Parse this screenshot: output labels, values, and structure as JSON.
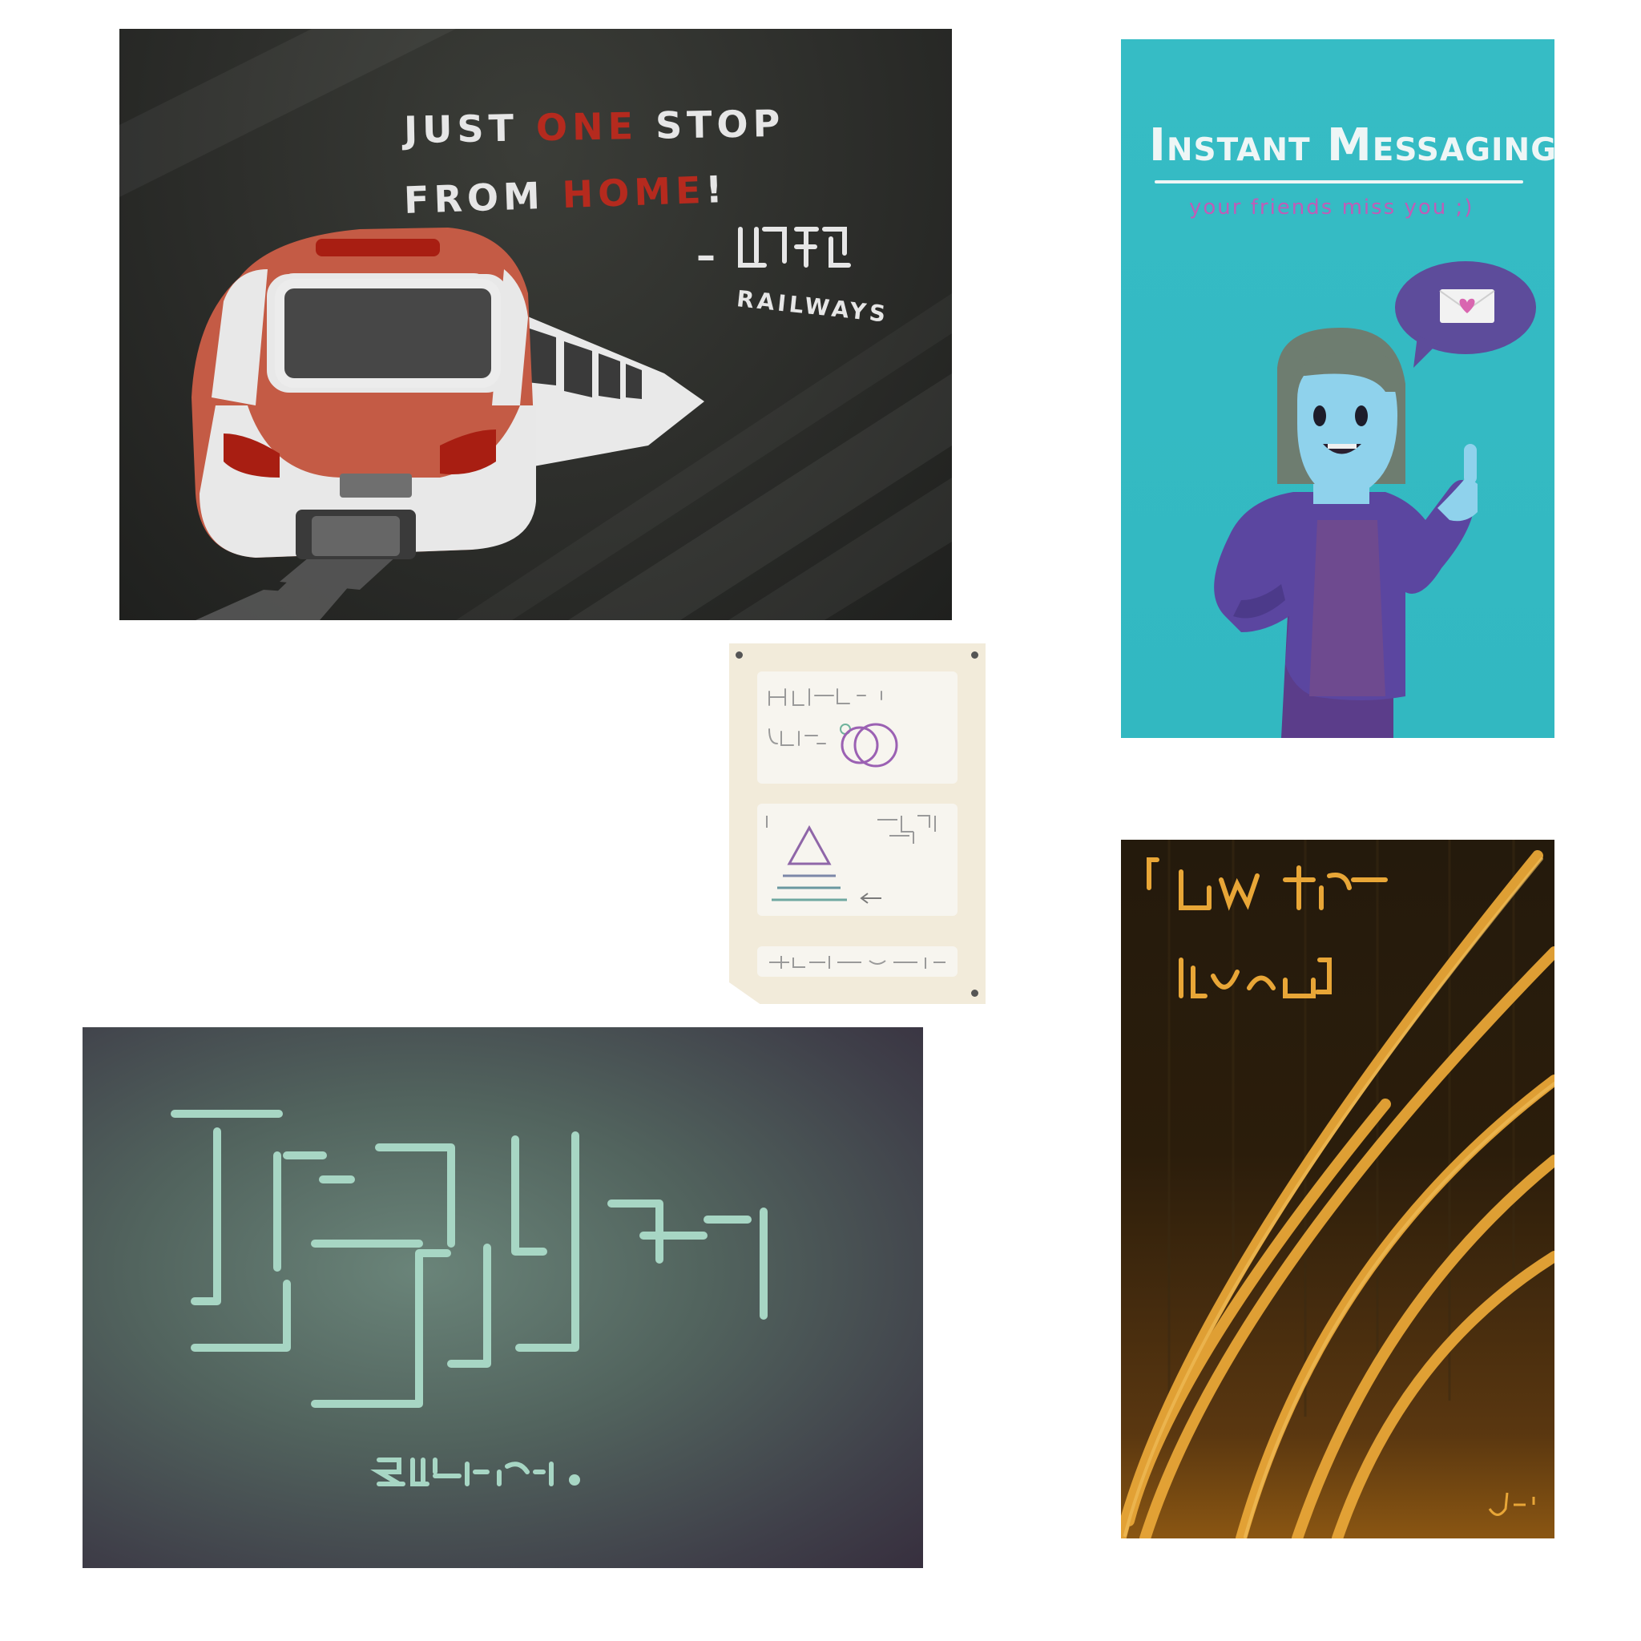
{
  "posters": {
    "train": {
      "line1_a": "JUST ",
      "line1_accent": "ONE",
      "line1_b": " STOP",
      "line2_a": "FROM ",
      "line2_accent": "HOME",
      "line2_b": "!",
      "brand": "RAILWAYS",
      "colors": {
        "background": "#2c2d2a",
        "accent": "#b52a1e",
        "text": "#e6e6e6",
        "train_body": "#c45b45"
      }
    },
    "messaging": {
      "title": "Instant Messaging",
      "subtitle": "your friends miss you ;)",
      "colors": {
        "background": "#36bcc5",
        "sweater": "#5b46a0",
        "skin": "#8fd2ec",
        "bubble": "#5d4c9b",
        "heart": "#d966b0"
      }
    },
    "chalkboard": {
      "colors": {
        "background": "#52645e",
        "chalk": "#a7d6c4"
      }
    },
    "amber": {
      "colors": {
        "background": "#2b1d0b",
        "stroke": "#e8a637"
      }
    },
    "note": {
      "colors": {
        "paper": "#f2ebda",
        "card": "#f7f5ef",
        "circle": "#9b61b3"
      }
    }
  }
}
